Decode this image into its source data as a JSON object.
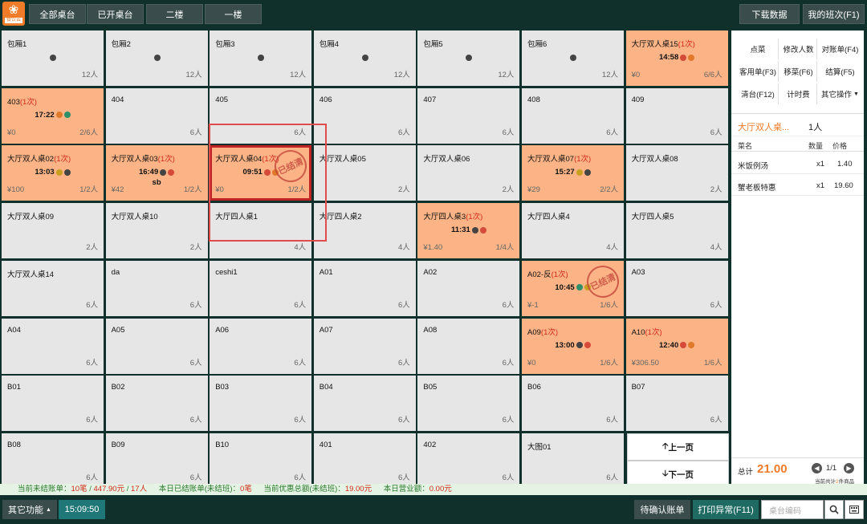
{
  "topbar": {
    "logo_text": "餐饮云",
    "tabs": [
      "全部桌台",
      "已开桌台",
      "二楼",
      "一楼"
    ],
    "download_label": "下载数据",
    "shift_label": "我的班次(F1)"
  },
  "tables": [
    {
      "name": "包厢1",
      "cap": "12人"
    },
    {
      "name": "包厢2",
      "cap": "12人"
    },
    {
      "name": "包厢3",
      "cap": "12人"
    },
    {
      "name": "包厢4",
      "cap": "12人"
    },
    {
      "name": "包厢5",
      "cap": "12人"
    },
    {
      "name": "包厢6",
      "cap": "12人"
    },
    {
      "name": "大厅双人桌15",
      "count": "(1次)",
      "time": "14:58",
      "amt": "¥0",
      "cap": "6/6人",
      "open": true
    },
    {
      "name": "403",
      "count": "(1次)",
      "time": "17:22",
      "amt": "¥0",
      "cap": "2/6人",
      "open": true
    },
    {
      "name": "404",
      "cap": "6人"
    },
    {
      "name": "405",
      "cap": "6人"
    },
    {
      "name": "406",
      "cap": "6人"
    },
    {
      "name": "407",
      "cap": "6人"
    },
    {
      "name": "408",
      "cap": "6人"
    },
    {
      "name": "409",
      "cap": "6人"
    },
    {
      "name": "大厅双人桌02",
      "count": "(1次)",
      "time": "13:03",
      "amt": "¥100",
      "cap": "1/2人",
      "open": true
    },
    {
      "name": "大厅双人桌03",
      "count": "(1次)",
      "time": "16:49",
      "note": "sb",
      "amt": "¥42",
      "cap": "1/2人",
      "open": true
    },
    {
      "name": "大厅双人桌04",
      "count": "(1次)",
      "time": "09:51",
      "amt": "¥0",
      "cap": "1/2人",
      "open": true,
      "selected": true,
      "stamp": "已结清"
    },
    {
      "name": "大厅双人桌05",
      "cap": "2人"
    },
    {
      "name": "大厅双人桌06",
      "cap": "2人"
    },
    {
      "name": "大厅双人桌07",
      "count": "(1次)",
      "time": "15:27",
      "amt": "¥29",
      "cap": "2/2人",
      "open": true
    },
    {
      "name": "大厅双人桌08",
      "cap": "2人"
    },
    {
      "name": "大厅双人桌09",
      "cap": "2人"
    },
    {
      "name": "大厅双人桌10",
      "cap": "2人"
    },
    {
      "name": "大厅四人桌1",
      "cap": "4人"
    },
    {
      "name": "大厅四人桌2",
      "cap": "4人"
    },
    {
      "name": "大厅四人桌3",
      "count": "(1次)",
      "time": "11:31",
      "amt": "¥1.40",
      "cap": "1/4人",
      "open": true
    },
    {
      "name": "大厅四人桌4",
      "cap": "4人"
    },
    {
      "name": "大厅四人桌5",
      "cap": "4人"
    },
    {
      "name": "大厅双人桌14",
      "cap": "6人"
    },
    {
      "name": "da",
      "cap": "6人"
    },
    {
      "name": "ceshi1",
      "cap": "6人"
    },
    {
      "name": "A01",
      "cap": "6人"
    },
    {
      "name": "A02",
      "cap": "6人"
    },
    {
      "name": "A02-反",
      "count": "(1次)",
      "time": "10:45",
      "amt": "¥-1",
      "cap": "1/6人",
      "open": true,
      "stamp": "已结清"
    },
    {
      "name": "A03",
      "cap": "6人"
    },
    {
      "name": "A04",
      "cap": "6人"
    },
    {
      "name": "A05",
      "cap": "6人"
    },
    {
      "name": "A06",
      "cap": "6人"
    },
    {
      "name": "A07",
      "cap": "6人"
    },
    {
      "name": "A08",
      "cap": "6人"
    },
    {
      "name": "A09",
      "count": "(1次)",
      "time": "13:00",
      "amt": "¥0",
      "cap": "1/6人",
      "open": true
    },
    {
      "name": "A10",
      "count": "(1次)",
      "time": "12:40",
      "amt": "¥306.50",
      "cap": "1/6人",
      "open": true
    },
    {
      "name": "B01",
      "cap": "6人"
    },
    {
      "name": "B02",
      "cap": "6人"
    },
    {
      "name": "B03",
      "cap": "6人"
    },
    {
      "name": "B04",
      "cap": "6人"
    },
    {
      "name": "B05",
      "cap": "6人"
    },
    {
      "name": "B06",
      "cap": "6人"
    },
    {
      "name": "B07",
      "cap": "6人"
    },
    {
      "name": "B08",
      "cap": "6人"
    },
    {
      "name": "B09",
      "cap": "6人"
    },
    {
      "name": "B10",
      "cap": "6人"
    },
    {
      "name": "401",
      "cap": "6人"
    },
    {
      "name": "402",
      "cap": "6人"
    },
    {
      "name": "大图01",
      "cap": "6人"
    }
  ],
  "pager": {
    "prev": "上一页",
    "next": "下一页"
  },
  "panel": {
    "actions": [
      "点菜",
      "修改人数",
      "对账单(F4)",
      "客用单(F3)",
      "移菜(F6)",
      "结算(F5)",
      "清台(F12)",
      "计时费",
      "其它操作"
    ],
    "table_name": "大厅双人桌...",
    "people": "1人",
    "headers": {
      "dish": "菜名",
      "qty": "数量",
      "price": "价格"
    },
    "orders": [
      {
        "dish": "米饭例汤",
        "qty": "x1",
        "price": "1.40"
      },
      {
        "dish": "蟹老板特惠",
        "qty": "x1",
        "price": "19.60"
      }
    ],
    "total_label": "总计",
    "total": "21.00",
    "page": "1/1",
    "count_prefix": "当前共计",
    "count_value": "2",
    "count_suffix": "件商品"
  },
  "status": {
    "l1": "当前未结账单：",
    "v1": "10笔",
    "s1": " / ",
    "v2": "447.90元",
    "s2": " / ",
    "v3": "17人",
    "l2": "本日已结账单(未结班)：",
    "v4": "0笔",
    "l3": "当前优惠总额(未结班)：",
    "v5": "19.00元",
    "l4": "本日营业额：",
    "v6": "0.00元"
  },
  "bottom": {
    "other_label": "其它功能",
    "clock": "15:09:50",
    "pending_label": "待确认账单",
    "print_error_label": "打印异常(F11)",
    "search_placeholder": "桌台编码"
  },
  "colors": {
    "open": "#fcb486",
    "idle": "#e6e6e6",
    "accent": "#f07b28",
    "bar": "#10302c"
  }
}
